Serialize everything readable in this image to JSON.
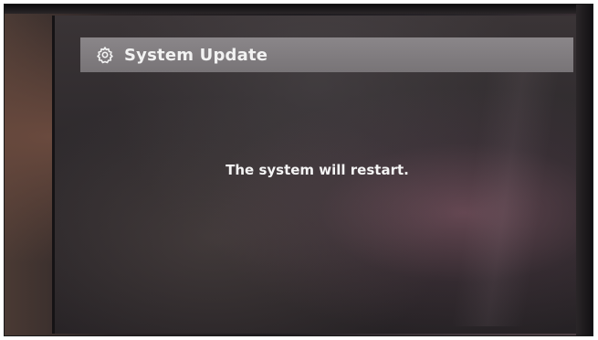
{
  "header": {
    "title": "System Update",
    "icon": "gear-icon"
  },
  "main": {
    "message": "The system will restart."
  },
  "colors": {
    "title_bar": "#807c7f",
    "text": "#f4f4f4",
    "screen_bg": "#2e2a2d"
  }
}
